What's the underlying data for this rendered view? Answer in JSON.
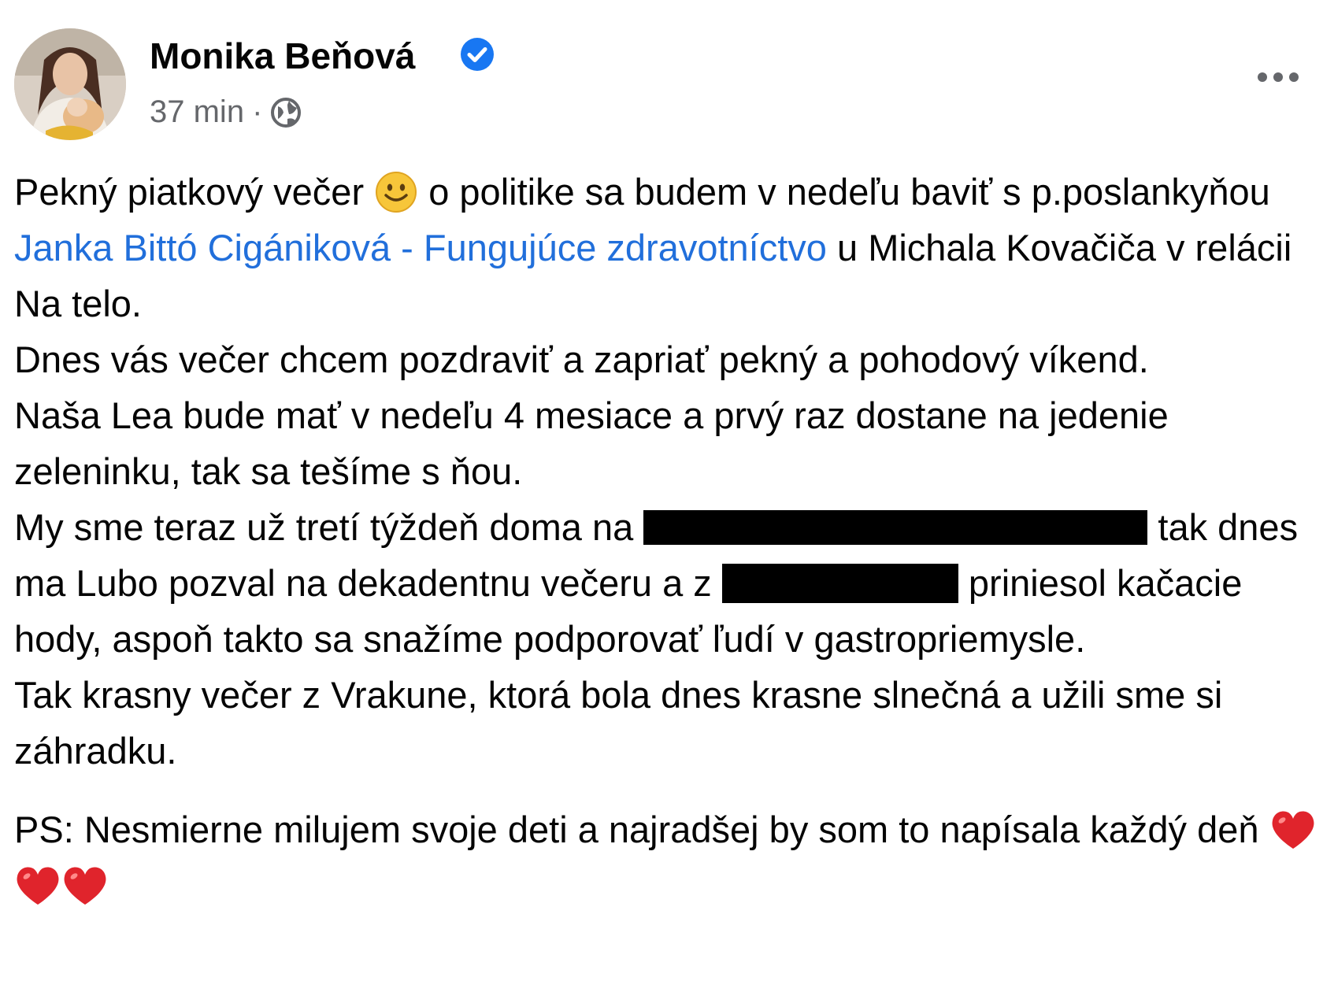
{
  "post": {
    "author": "Monika Beňová",
    "time": "37 min",
    "separator": "·",
    "paragraphs": {
      "p1_a": "Pekný piatkový večer",
      "p1_b": "o politike sa budem v nedeľu baviť s p.poslankyňou",
      "p1_link": "Janka Bittó Cigániková - Fungujúce zdravotníctvo",
      "p1_c": "u Michala Kovačiča v relácii Na telo.",
      "p2": "Dnes vás večer chcem pozdraviť a zapriať pekný a pohodový víkend.",
      "p3": "Naša Lea bude mať v nedeľu 4 mesiace a prvý raz dostane na jedenie zeleninku, tak sa tešíme s ňou.",
      "p4_a": "My sme teraz už tretí týždeň doma na",
      "p4_b": "tak dnes ma Lubo pozval na dekadentnu večeru a z",
      "p4_c": "priniesol kačacie hody, aspoň takto sa snažíme podporovať ľudí v gastropriemysle.",
      "p5": "Tak krasny večer z Vrakune, ktorá bola dnes krasne slnečná a užili sme si záhradku.",
      "ps": "PS: Nesmierne milujem svoje deti a najradšej by som to napísala každý deň"
    }
  },
  "icons": {
    "verified": "verified-badge-icon",
    "privacy": "globe-icon",
    "more": "more-options-icon",
    "smile": "smiling-face-emoji",
    "heart": "red-heart-emoji"
  },
  "colors": {
    "link": "#216fdb",
    "meta": "#65676b",
    "verified": "#1877f2",
    "text": "#050505"
  }
}
